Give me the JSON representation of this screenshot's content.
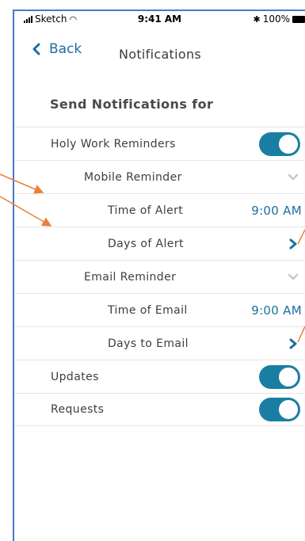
{
  "status_bar": {
    "carrier": "Sketch",
    "time": "9:41 AM",
    "battery": "100%"
  },
  "nav": {
    "back_label": "Back",
    "title": "Notifications"
  },
  "section": {
    "header": "Send Notifications for"
  },
  "rows": {
    "holy_work": {
      "label": "Holy Work Reminders",
      "toggle_on": true
    },
    "mobile": {
      "label": "Mobile Reminder"
    },
    "time_alert": {
      "label": "Time of Alert",
      "value": "9:00 AM"
    },
    "days_alert": {
      "label": "Days of Alert"
    },
    "email": {
      "label": "Email Reminder"
    },
    "time_email": {
      "label": "Time of Email",
      "value": "9:00 AM"
    },
    "days_email": {
      "label": "Days to Email"
    },
    "updates": {
      "label": "Updates",
      "toggle_on": true
    },
    "requests": {
      "label": "Requests",
      "toggle_on": true
    }
  },
  "colors": {
    "accent": "#1a7ea3",
    "annotation": "#e8813a",
    "frame": "#4a77c9"
  },
  "icons": {
    "back": "chevron-left-icon",
    "expand": "chevron-down-icon",
    "disclosure": "chevron-right-icon"
  }
}
